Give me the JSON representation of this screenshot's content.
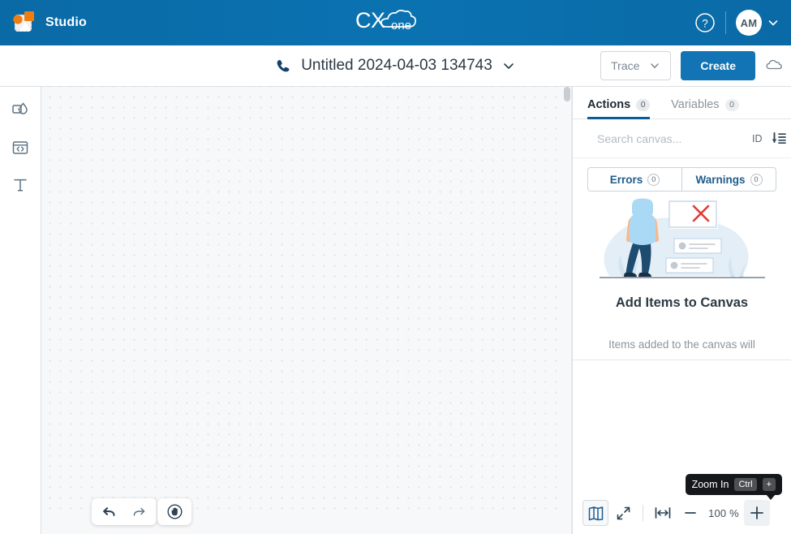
{
  "header": {
    "app_name": "Studio",
    "logo_icon": "studio-logo-icon",
    "brand_logo": "cxone-cloud-logo",
    "brand_text_cx": "CX",
    "brand_text_one": "one",
    "help_icon": "help-question-icon",
    "avatar_initials": "AM",
    "avatar_chevron_icon": "chevron-down-icon",
    "bg_color": "#0a6aa6"
  },
  "toolbar": {
    "phone_icon": "phone-icon",
    "flow_name": "Untitled 2024-04-03 134743",
    "flow_chevron_icon": "chevron-down-icon",
    "trace_label": "Trace",
    "trace_chevron_icon": "chevron-down-icon",
    "create_label": "Create",
    "cloud_icon": "cloud-icon",
    "create_color": "#1274b4"
  },
  "rail": {
    "items": [
      {
        "name": "shapes-tool",
        "icon": "shapes-icon"
      },
      {
        "name": "code-tool",
        "icon": "code-window-icon"
      },
      {
        "name": "text-tool",
        "icon": "text-t-icon"
      }
    ]
  },
  "canvas": {
    "undo_icon": "undo-arrow-icon",
    "redo_icon": "redo-arrow-icon",
    "pan_icon": "hand-pan-icon",
    "grid": "dotted"
  },
  "panel": {
    "tabs": [
      {
        "label": "Actions",
        "badge": "0",
        "active": true
      },
      {
        "label": "Variables",
        "badge": "0",
        "active": false
      }
    ],
    "search": {
      "icon": "search-icon",
      "placeholder": "Search canvas...",
      "value": "",
      "id_label": "ID",
      "sort_icon": "sort-descending-icon"
    },
    "segments": [
      {
        "label": "Errors",
        "badge": "0"
      },
      {
        "label": "Warnings",
        "badge": "0"
      }
    ],
    "empty_state": {
      "illustration": "person-with-empty-cards-illustration",
      "title": "Add Items to Canvas",
      "subtitle": "Items added to the canvas will"
    }
  },
  "zoom_controls": {
    "minimap_icon": "minimap-book-icon",
    "fullscreen_icon": "expand-diagonal-icon",
    "fit_width_icon": "fit-width-icon",
    "zoom_out_icon": "minus-icon",
    "zoom_level": "100 %",
    "zoom_in_icon": "plus-icon",
    "tooltip": {
      "text": "Zoom In",
      "key_modifier": "Ctrl",
      "key_main": "+"
    }
  }
}
